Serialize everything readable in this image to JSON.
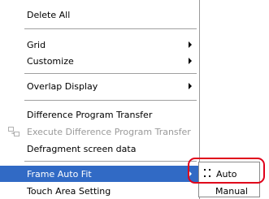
{
  "menu": {
    "delete_all": "Delete All",
    "grid": "Grid",
    "customize": "Customize",
    "overlap_display": "Overlap Display",
    "difference_program_transfer": "Difference Program Transfer",
    "execute_difference_program_transfer": "Execute Difference Program Transfer",
    "defragment_screen_data": "Defragment screen data",
    "frame_auto_fit": "Frame Auto Fit",
    "touch_area_setting": "Touch Area Setting"
  },
  "submenu": {
    "auto": "Auto",
    "manual": "Manual"
  },
  "colors": {
    "selection": "#316ac5",
    "highlight_ring": "#e0001a",
    "disabled_text": "#9a9a9a"
  }
}
